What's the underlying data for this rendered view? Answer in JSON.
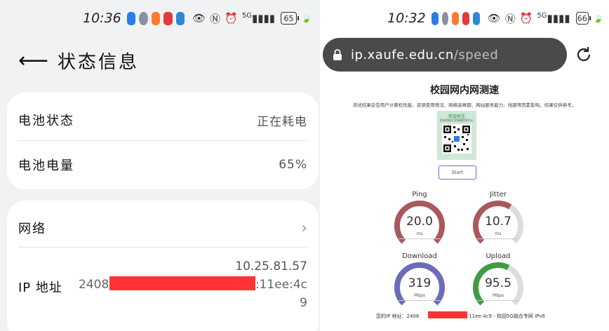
{
  "left": {
    "status_bar": {
      "time": "10:36",
      "battery": "65",
      "net": "5G",
      "app_icons": [
        {
          "name": "star-app-icon",
          "color": "#2b7de9"
        },
        {
          "name": "settings-app-icon",
          "color": "#8a8fa3"
        },
        {
          "name": "heart-app-icon",
          "color": "#ff7a2e"
        },
        {
          "name": "video-app-icon",
          "color": "#e23a3a"
        },
        {
          "name": "notes-app-icon",
          "color": "#2f86d6"
        }
      ]
    },
    "header": {
      "title": "状态信息"
    },
    "card1": {
      "rows": [
        {
          "key": "电池状态",
          "value": "正在耗电"
        },
        {
          "key": "电池电量",
          "value": "65%"
        }
      ]
    },
    "card2": {
      "network_label": "网络",
      "ip": {
        "label": "IP 地址",
        "v4": "10.25.81.57",
        "v6_prefix": "2408",
        "v6_suffix": ":11ee:4c",
        "v6_last": "9"
      }
    }
  },
  "right": {
    "status_bar": {
      "time": "10:32",
      "battery": "66",
      "net": "5G"
    },
    "url": {
      "host": "ip.xaufe.edu.cn",
      "path": "/speed"
    },
    "page": {
      "title": "校园网内网测速",
      "subtitle": "测试结果会受用户计算机性能、资源使用情况、网络高峰期、网站服务能力、线路等因素影响，结果仅供参考。",
      "qr_title": "欢迎关注",
      "qr_sub": "西安财经大学网络信息中心",
      "start_label": "Start"
    },
    "gauges": [
      {
        "name": "ping",
        "label": "Ping",
        "value": "20.0",
        "unit": "ms",
        "color": "#a9585b",
        "fill": 1.0
      },
      {
        "name": "jitter",
        "label": "Jitter",
        "value": "10.7",
        "unit": "ms",
        "color": "#a9585b",
        "fill": 0.62
      },
      {
        "name": "download",
        "label": "Download",
        "value": "319",
        "unit": "Mbps",
        "color": "#6b6db8",
        "fill": 1.0
      },
      {
        "name": "upload",
        "label": "Upload",
        "value": "95.5",
        "unit": "Mbps",
        "color": "#3f9b44",
        "fill": 0.6
      }
    ],
    "footer": {
      "prefix": "您的IP 地址：2408",
      "suffix": ":11ee:4c9 - 校园5G融合专网 IPv6"
    }
  }
}
